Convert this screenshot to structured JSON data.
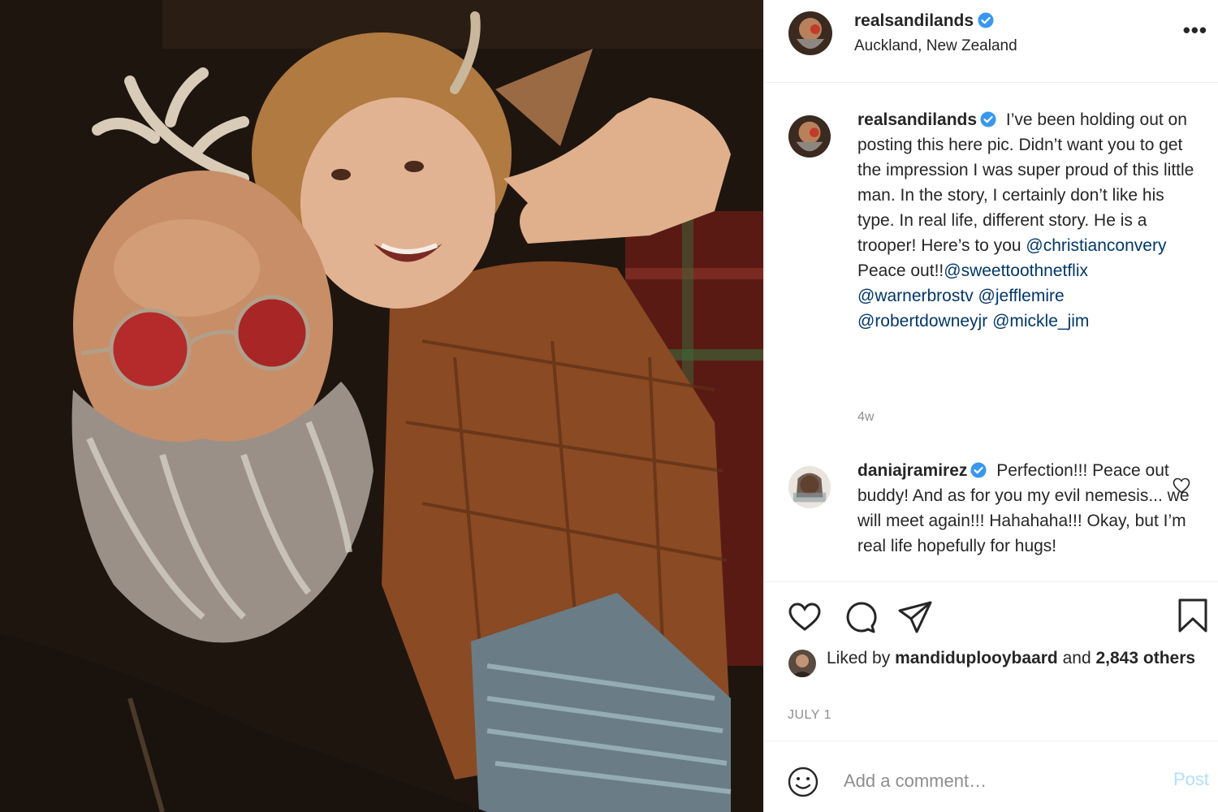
{
  "header": {
    "username": "realsandilands",
    "location": "Auckland, New Zealand",
    "more_label": "•••"
  },
  "caption": {
    "username": "realsandilands",
    "text_before": "I’ve been holding out on posting this here pic. Didn’t want you to get the impression I was super proud of this little man. In the story, I certainly don’t like his type. In real life, different story. He is a trooper! Here’s to you",
    "mention1": "@christianconvery",
    "text_mid": "Peace out!!",
    "mention2": "@sweettoothnetflix",
    "mention3": "@warnerbrostv",
    "mention4": "@jefflemire",
    "mention5": "@robertdowneyjr",
    "mention6": "@mickle_jim",
    "time_ago": "4w"
  },
  "comment1": {
    "username": "daniajramirez",
    "text": "Perfection!!! Peace out buddy! And as for you my evil nemesis... we will meet again!!! Hahahaha!!! Okay, but I’m real life hopefully for hugs!"
  },
  "likes": {
    "prefix": "Liked by",
    "user": "mandiduplooybaard",
    "suffix": "and",
    "others": "2,843 others"
  },
  "date": "JULY 1",
  "add_comment": {
    "placeholder": "Add a comment…",
    "post_label": "Post"
  },
  "colors": {
    "verified": "#3897f0",
    "mention": "#00376b",
    "muted": "#8e8e8e",
    "post_disabled": "#b2dffc"
  },
  "icons": [
    "more-icon",
    "verified-icon",
    "heart-icon",
    "comment-icon",
    "share-icon",
    "bookmark-icon",
    "emoji-icon"
  ]
}
